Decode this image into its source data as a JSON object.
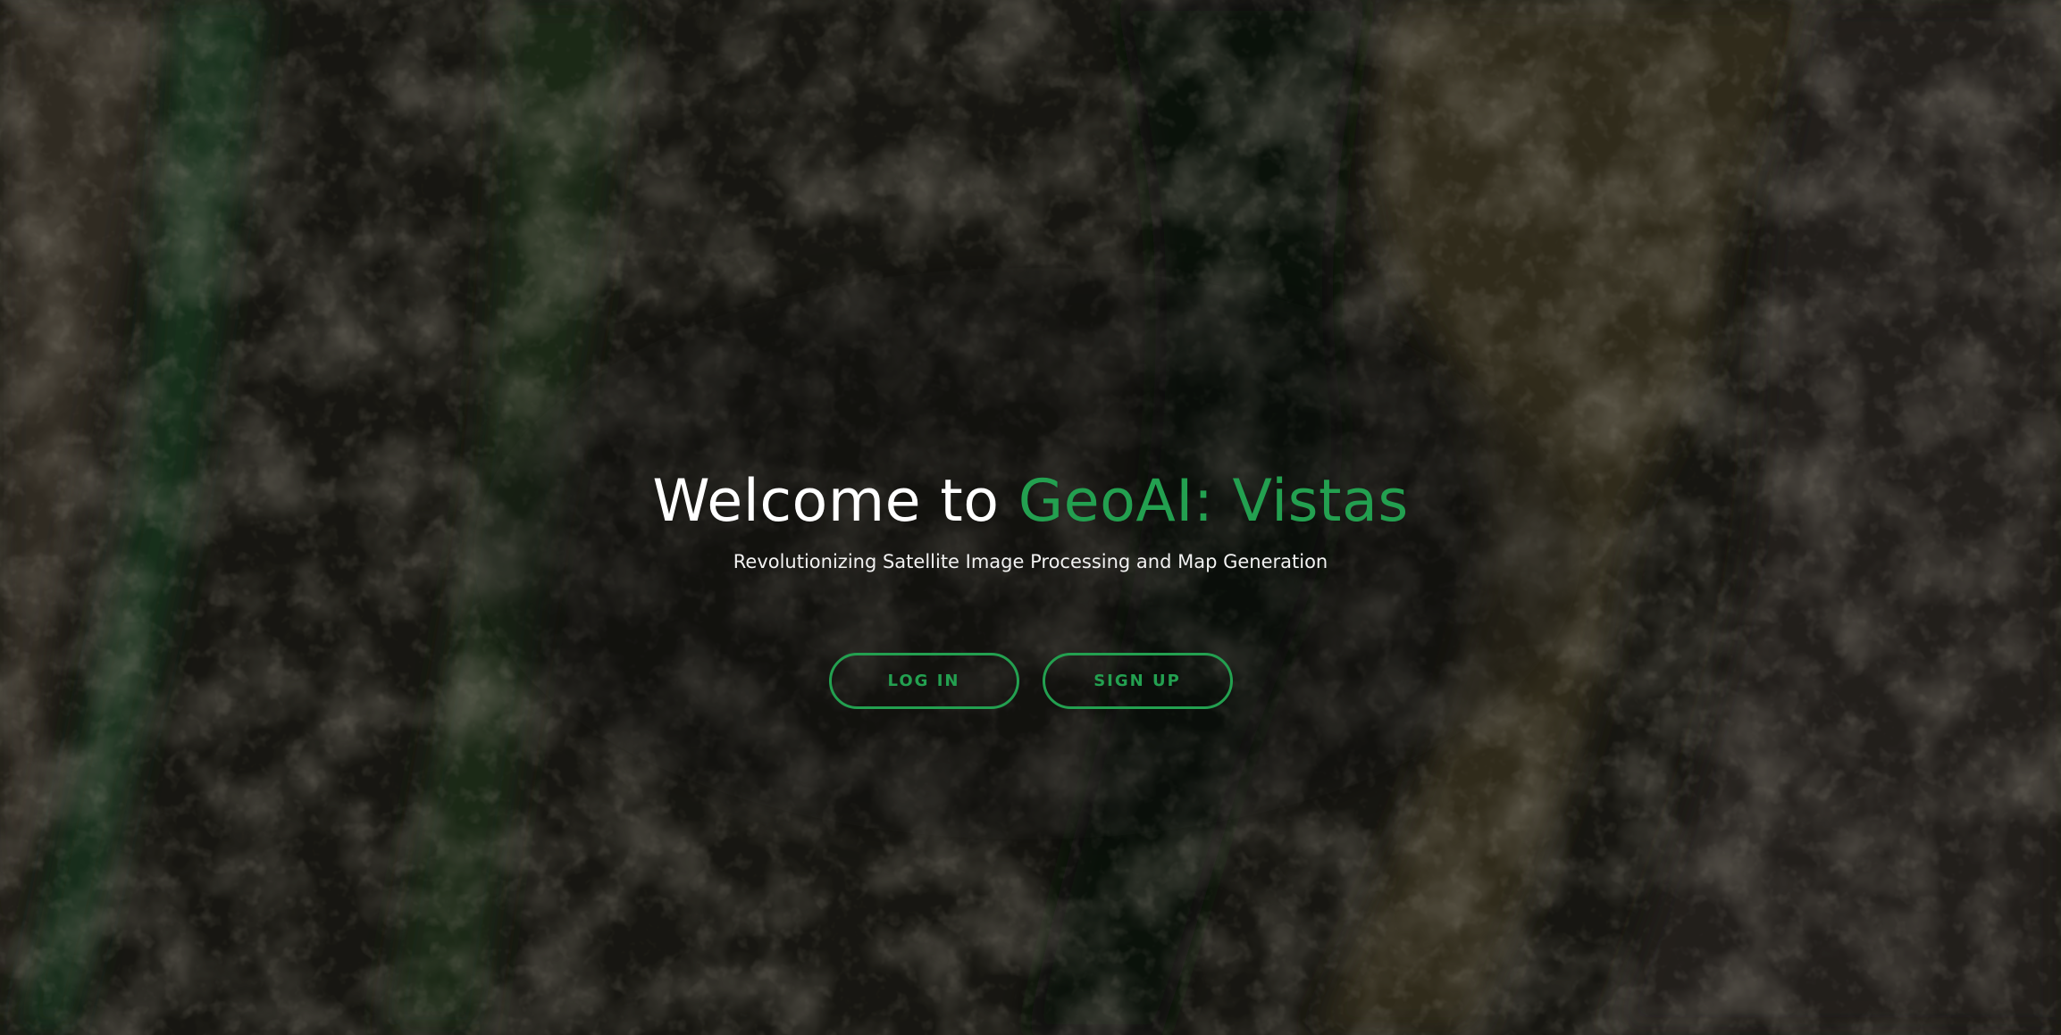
{
  "hero": {
    "title_prefix": "Welcome to ",
    "title_brand": "GeoAI: Vistas",
    "subtitle": "Revolutionizing Satellite Image Processing and Map Generation",
    "login_label": "LOG IN",
    "signup_label": "SIGN UP"
  },
  "colors": {
    "accent": "#23a050",
    "text": "#ffffff",
    "background": "#1a1a14"
  }
}
